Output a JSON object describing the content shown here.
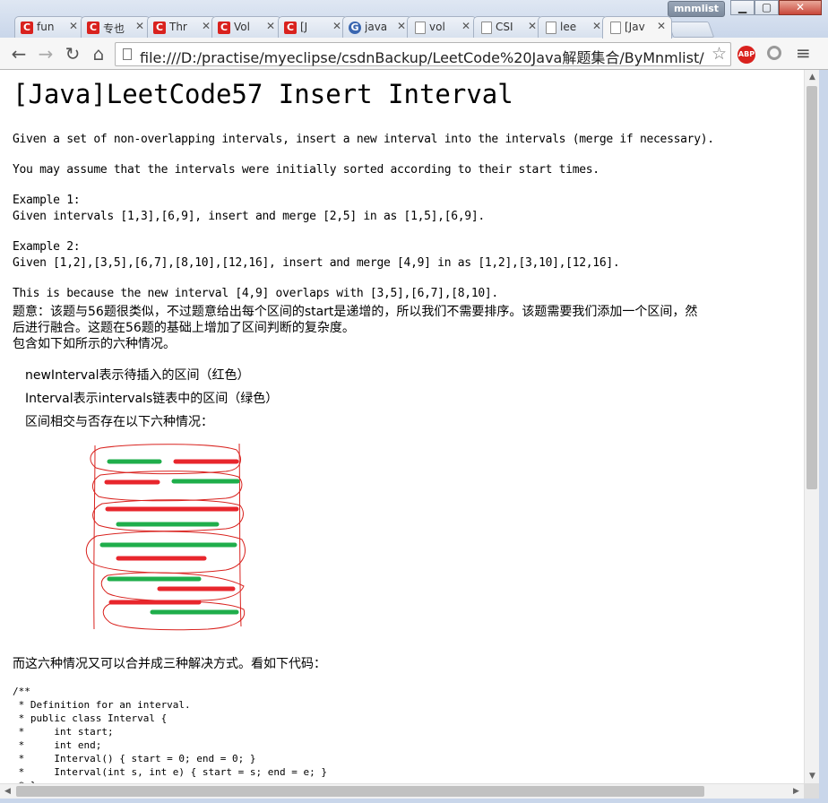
{
  "window": {
    "profile_name": "mnmlist",
    "minimize": "▁",
    "maximize": "▢",
    "close": "✕"
  },
  "tabs": [
    {
      "label": "fun",
      "icon": "csdn-icon"
    },
    {
      "label": "专也",
      "icon": "csdn-icon"
    },
    {
      "label": "Thr",
      "icon": "csdn-icon"
    },
    {
      "label": "Vol",
      "icon": "csdn-icon"
    },
    {
      "label": "[J",
      "icon": "csdn-icon"
    },
    {
      "label": "java",
      "icon": "java-site-icon"
    },
    {
      "label": "vol",
      "icon": "document-icon"
    },
    {
      "label": "CSI",
      "icon": "document-icon"
    },
    {
      "label": "lee",
      "icon": "document-icon"
    },
    {
      "label": "[Jav",
      "icon": "document-icon"
    }
  ],
  "toolbar": {
    "back": "←",
    "forward": "→",
    "reload": "↻",
    "home": "⌂",
    "url": "file:///D:/practise/myeclipse/csdnBackup/LeetCode%20Java解题集合/ByMnmlist/[Ja",
    "bookmark_star": "☆",
    "adblock_label": "ABP",
    "menu": "≡"
  },
  "page": {
    "title": "[Java]LeetCode57 Insert Interval",
    "p1": "Given a set of non-overlapping intervals, insert a new interval into the intervals (merge if necessary).",
    "p2": "You may assume that the intervals were initially sorted according to their start times.",
    "ex1_label": "Example 1:",
    "ex1_body": "Given intervals [1,3],[6,9], insert and merge [2,5] in as [1,5],[6,9].",
    "ex2_label": "Example 2:",
    "ex2_body": "Given [1,2],[3,5],[6,7],[8,10],[12,16], insert and merge [4,9] in as [1,2],[3,10],[12,16].",
    "p3": "This is because the new interval [4,9] overlaps with [3,5],[6,7],[8,10].",
    "cn1a": "题意：该题与56题很类似，不过题意给出每个区间的start是递增的，所以我们不需要排序。该题需要我们添加一个区间，然",
    "cn1b": "后进行融合。这题在56题的基础上增加了区间判断的复杂度。",
    "cn2": "包含如下如所示的六种情况。",
    "bullet1": "newInterval表示待插入的区间（红色）",
    "bullet2": "Interval表示intervals链表中的区间（绿色）",
    "bullet3": "区间相交与否存在以下六种情况：",
    "cn3": "而这六种情况又可以合并成三种解决方式。看如下代码：",
    "code": "/**\n * Definition for an interval.\n * public class Interval {\n *     int start;\n *     int end;\n *     Interval() { start = 0; end = 0; }\n *     Interval(int s, int e) { start = s; end = e; }\n * }"
  },
  "colors": {
    "new_interval_red": "#e8262c",
    "interval_green": "#1fae4b",
    "sketch_red": "#d9221e"
  }
}
